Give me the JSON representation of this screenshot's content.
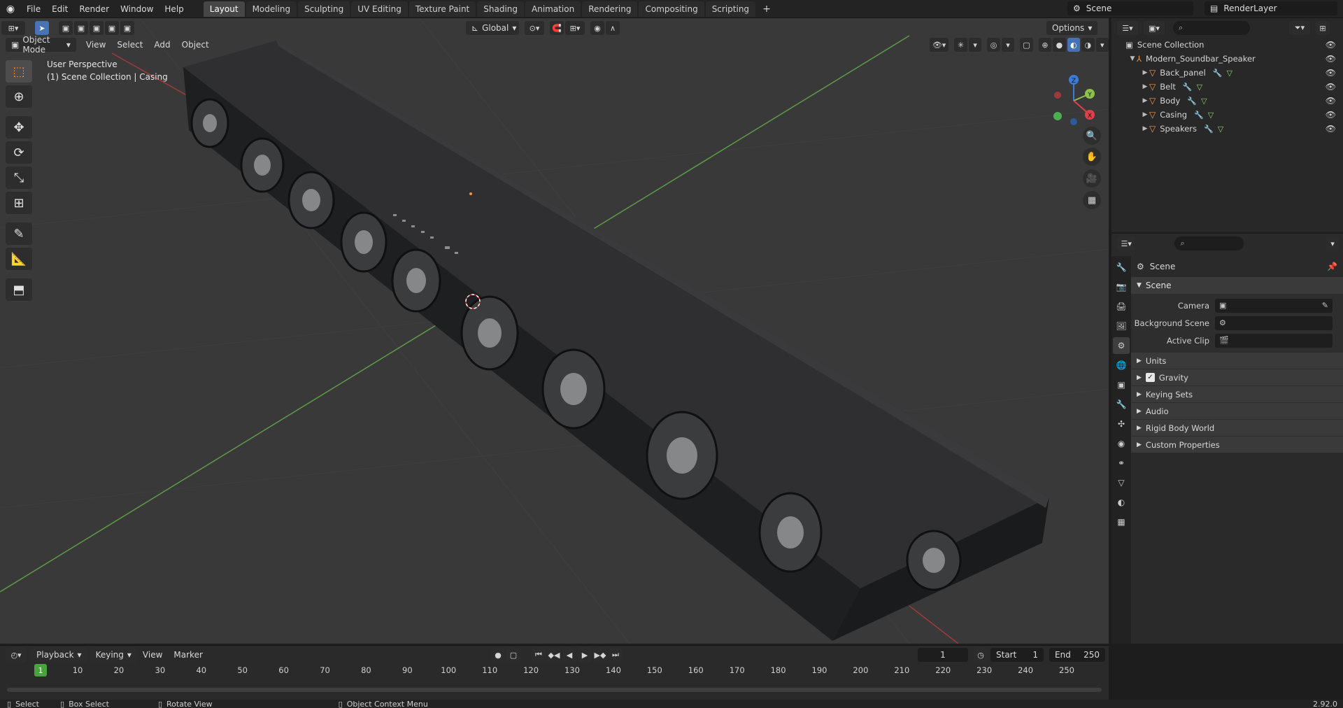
{
  "topbar": {
    "menus": [
      "File",
      "Edit",
      "Render",
      "Window",
      "Help"
    ],
    "workspaces": [
      "Layout",
      "Modeling",
      "Sculpting",
      "UV Editing",
      "Texture Paint",
      "Shading",
      "Animation",
      "Rendering",
      "Compositing",
      "Scripting"
    ],
    "active_workspace": "Layout",
    "add_tab": "+",
    "scene_name": "Scene",
    "view_layer": "RenderLayer"
  },
  "viewport": {
    "mode": "Object Mode",
    "menus": [
      "View",
      "Select",
      "Add",
      "Object"
    ],
    "transform_orientation": "Global",
    "options_label": "Options",
    "overlay_line1": "User Perspective",
    "overlay_line2": "(1) Scene Collection | Casing"
  },
  "gizmo": {
    "x": "X",
    "y": "Y",
    "z": "Z",
    "colors": {
      "x": "#e0404c",
      "y": "#8bc34a",
      "z": "#3d7cd6"
    }
  },
  "outliner": {
    "root": "Scene Collection",
    "collection": "Modern_Soundbar_Speaker",
    "objects": [
      "Back_panel",
      "Belt",
      "Body",
      "Casing",
      "Speakers"
    ]
  },
  "properties": {
    "context": "Scene",
    "panel_title": "Scene",
    "fields": [
      {
        "label": "Camera",
        "icon": "camera-icon"
      },
      {
        "label": "Background Scene",
        "icon": "scene-icon"
      },
      {
        "label": "Active Clip",
        "icon": "clip-icon"
      }
    ],
    "subpanels": [
      "Units",
      "Gravity",
      "Keying Sets",
      "Audio",
      "Rigid Body World",
      "Custom Properties"
    ],
    "gravity_checked": true
  },
  "timeline": {
    "menus": [
      "Playback",
      "Keying",
      "View",
      "Marker"
    ],
    "current_frame": "1",
    "start_label": "Start",
    "start_value": "1",
    "end_label": "End",
    "end_value": "250",
    "ruler": [
      "1",
      "10",
      "20",
      "30",
      "40",
      "50",
      "60",
      "70",
      "80",
      "90",
      "100",
      "110",
      "120",
      "130",
      "140",
      "150",
      "160",
      "170",
      "180",
      "190",
      "200",
      "210",
      "220",
      "230",
      "240",
      "250"
    ]
  },
  "statusbar": {
    "select": "Select",
    "box_select": "Box Select",
    "rotate_view": "Rotate View",
    "context_menu": "Object Context Menu",
    "version": "2.92.0"
  },
  "colors": {
    "accent": "#4772b3",
    "object_orange": "#f29a3a",
    "timeline_current": "#4aa33f"
  }
}
